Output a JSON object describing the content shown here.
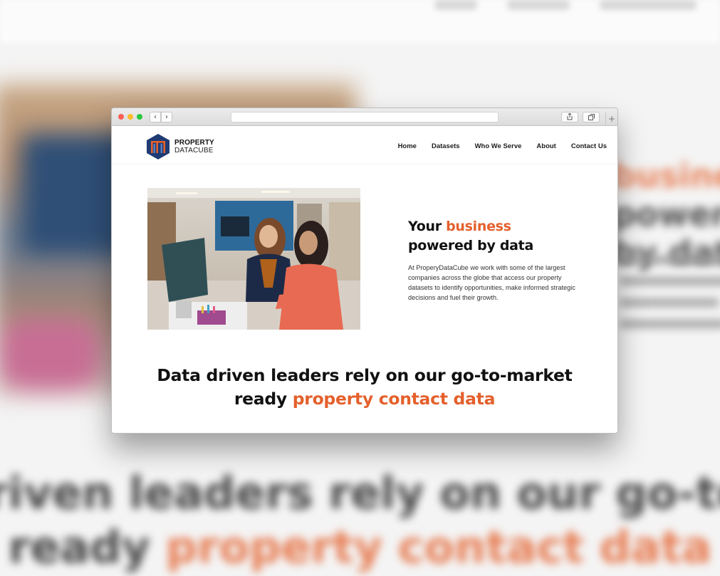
{
  "site": {
    "logo": {
      "line1": "PROPERTY",
      "line2": "DATACUBE"
    },
    "nav": [
      "Home",
      "Datasets",
      "Who We Serve",
      "About",
      "Contact Us"
    ],
    "hero": {
      "title_prefix": "Your ",
      "title_highlight": "business",
      "title_line2": "powered by data",
      "description": "At ProperyDataCube we work with some of the largest companies across the globe that access our property datasets to identify opportunities, make informed strategic decisions and fuel their growth."
    },
    "tagline": {
      "line1": "Data driven leaders rely on our go-to-market",
      "line2_prefix": "ready ",
      "line2_highlight": "property contact data"
    }
  },
  "browser": {
    "back_icon": "chevron-left-icon",
    "forward_icon": "chevron-right-icon",
    "share_icon": "share-icon",
    "tabs_icon": "tabs-icon",
    "new_tab_icon": "plus-icon"
  },
  "colors": {
    "accent": "#e4602c",
    "logo_navy": "#1f3b73",
    "logo_orange": "#e4602c"
  }
}
